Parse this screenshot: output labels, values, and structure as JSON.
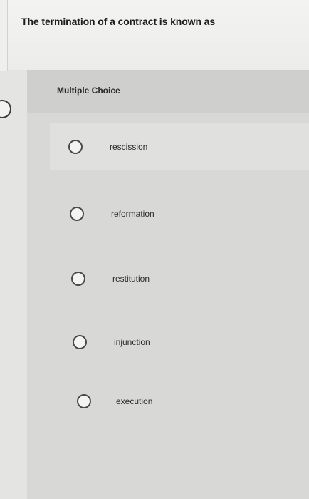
{
  "question": {
    "text": "The termination of a contract is known as"
  },
  "panel": {
    "header": "Multiple Choice"
  },
  "choices": [
    {
      "label": "rescission",
      "selected": false
    },
    {
      "label": "reformation",
      "selected": false
    },
    {
      "label": "restitution",
      "selected": false
    },
    {
      "label": "injunction",
      "selected": false
    },
    {
      "label": "execution",
      "selected": false
    }
  ]
}
